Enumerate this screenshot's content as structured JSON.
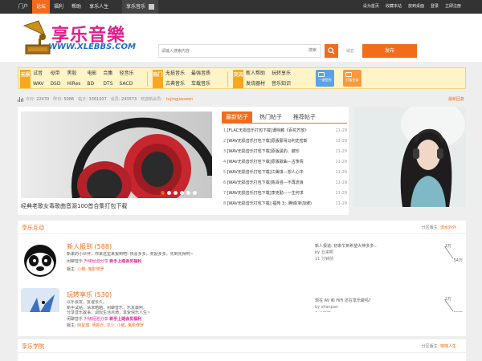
{
  "topbar": {
    "nav": [
      "门户",
      "论坛",
      "福利",
      "帮助",
      "享乐人生"
    ],
    "active_index": 1,
    "app_label": "享乐音乐",
    "right_links": [
      "设为首页",
      "收藏本站",
      "放到桌面",
      "登录",
      "立即注册"
    ]
  },
  "header": {
    "logo_title": "享乐音樂",
    "logo_url": "WWW.XLEBBS.COM",
    "search_placeholder": "请输入搜索内容",
    "search_type": "搜索",
    "hot_label": "域名",
    "post_button": "发布"
  },
  "categories": [
    {
      "tag": "无损",
      "links": [
        "试音",
        "母带",
        "黑胶",
        "电影",
        "合集",
        "轻音乐",
        "WAV",
        "DSD",
        "HiRes",
        "BD",
        "DTS",
        "SACD"
      ]
    },
    {
      "tag": "热门",
      "links": [
        "无损音乐",
        "最强音质",
        "古典音乐",
        "车载音乐"
      ]
    },
    {
      "tag": "交流",
      "links": [
        "新人帮助",
        "玩转享乐",
        "发烧器材",
        "音乐知识"
      ]
    }
  ],
  "quick_buttons": [
    {
      "label": "一键签到",
      "color": "#5aa2e8"
    },
    {
      "label": "升级任务",
      "color": "#f59a42"
    }
  ],
  "stats": {
    "items": [
      {
        "k": "今日:",
        "v": "22470"
      },
      {
        "k": "昨日:",
        "v": "5086"
      },
      {
        "k": "帖子:",
        "v": "3361007"
      },
      {
        "k": "会员:",
        "v": "243573"
      }
    ],
    "welcome": "欢迎新会员:",
    "new_user": "tujingjiaowen",
    "latest": "最新回复"
  },
  "slider": {
    "caption": "经典老歌女毒歌曲音源100首合集打包下载",
    "dots": 6,
    "active_dot": 0
  },
  "tabs": [
    "最新帖子",
    "热门帖子",
    "推荐帖子"
  ],
  "active_tab": 0,
  "posts": [
    {
      "n": "1",
      "title": "[FLAC无损音乐打包下载]谭咏麟《百花齐放》",
      "date": "11-29"
    },
    {
      "n": "2",
      "title": "[WAV无损音乐打包下载]原版蒙哥马利史密斯",
      "date": "11-29"
    },
    {
      "n": "3",
      "title": "[WAV无损音乐打包下载]原版黑豹、披珍",
      "date": "11-29"
    },
    {
      "n": "4",
      "title": "[WAV无损音乐打包下载]原版歌曲－古筝情",
      "date": "11-29"
    },
    {
      "n": "5",
      "title": "[WAV无损音乐打包下载]江美琪－想人心中",
      "date": "11-29"
    },
    {
      "n": "6",
      "title": "[WAV无损音乐打包下载]陈百强－不再流浪",
      "date": "11-29"
    },
    {
      "n": "7",
      "title": "[WAV无损音乐打包下载]李克勤－一生何求",
      "date": "11-29"
    },
    {
      "n": "8",
      "title": "[WAV无损音乐打包下载] 福苑 3：腾城(新加坡)",
      "date": "11-29"
    }
  ],
  "sections": [
    {
      "title": "享乐互动",
      "mod_label": "分区版主:",
      "mod_name": "流水外外",
      "forums": [
        {
          "name": "新人报到",
          "count": "(588)",
          "desc1": "新来的小伙伴，你来这里来报到吧! 快喜多多，奖励多多，先到先得哟~",
          "desc2a": "闲聊音乐",
          "desc2b": "升级经验分享",
          "desc2c": "新手上路会员福利",
          "mods_label": "版主:",
          "mods": "小鹅, 鬼影修罗",
          "last_title": "新人报道: 初来乍到希望大神多多...",
          "last_by": "by 云来啊",
          "last_time": "11 分钟前",
          "count_top": "2万",
          "count_bottom": "54万"
        },
        {
          "name": "玩转享乐",
          "count": "(530)",
          "desc1": "以乐会友，友谊长久。",
          "desc1b": "新手试贴，请求晒晒，闲聊音乐，乐友最照。",
          "desc1c": "分享音乐故事，调侃生活点滴，享受快乐人生~",
          "desc2a": "闲聊音乐",
          "desc2b": "升级经验分享",
          "desc2c": "新手上路会员福利",
          "mods_label": "版主:",
          "mods": "晓星悠, 明颜乐, 龙少, 小鹅, 鬼影修罗",
          "last_title": "现在 AV 和 HiFi 还在享乐做吗?",
          "last_by": "by shanpan",
          "last_time": "6 分钟前",
          "count_top": "2万",
          "count_bottom": "30万"
        }
      ]
    },
    {
      "title": "享乐学院",
      "mod_label": "分区版主:",
      "mod_name": "咖咖人生"
    }
  ]
}
